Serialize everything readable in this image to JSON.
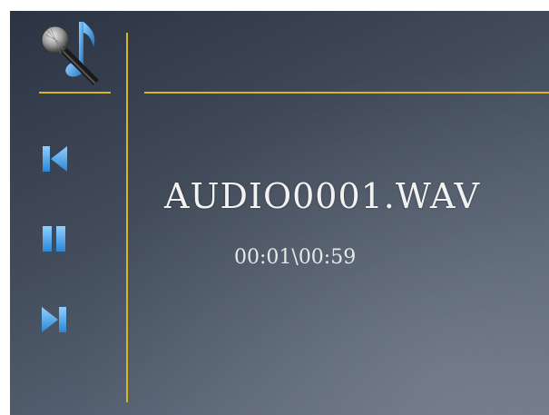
{
  "player": {
    "filename": "AUDIO0001.WAV",
    "time": "00:01\\00:59"
  },
  "icons": {
    "app": "microphone-music-note-icon",
    "previous": "skip-previous-icon",
    "pause": "pause-icon",
    "next": "skip-next-icon"
  },
  "colors": {
    "accent_line": "#d9b61e",
    "control_blue": "#3aa0e8",
    "text": "#f2f2f2"
  }
}
